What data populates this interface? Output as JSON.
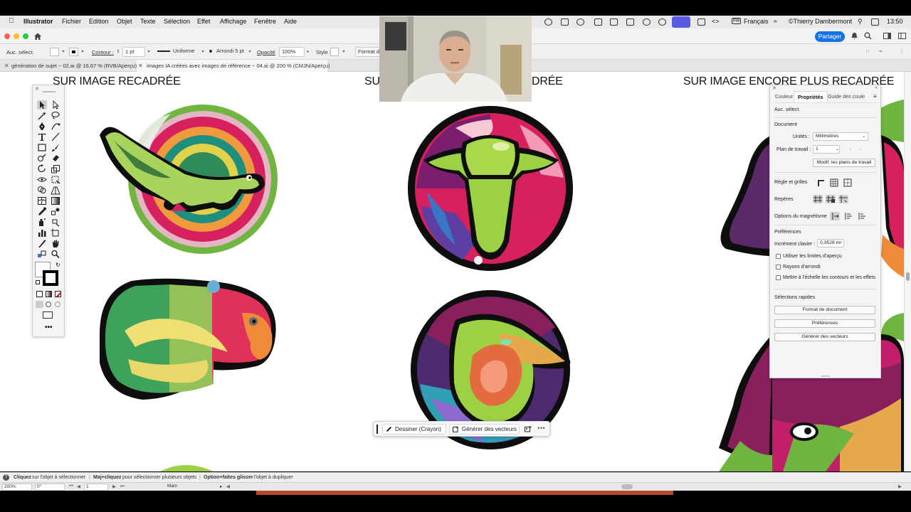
{
  "menubar": {
    "app_name": "Illustrator",
    "items": [
      "Fichier",
      "Edition",
      "Objet",
      "Texte",
      "Sélection",
      "Effet",
      "Affichage",
      "Fenêtre",
      "Aide"
    ],
    "input_code": "FR",
    "input_lang": "Français",
    "user": "©Thierry Dambermont",
    "clock": "13:50"
  },
  "approw": {
    "share_label": "Partager"
  },
  "controlbar": {
    "selection": "Auc. sélect.",
    "stroke_label": "Contour :",
    "stroke_weight": "1 pt",
    "stroke_profile": "Uniforme",
    "brush": "Arrondi 5 pt",
    "opacity_label": "Opacité",
    "opacity_value": "100%",
    "style_label": "Style :",
    "doc_format": "Format de"
  },
  "tabs": [
    {
      "label": "génération de sujet ~ 02.ai @ 16,67 % (RVB/Aperçu)",
      "active": false
    },
    {
      "label": "images IA créées avec images de référence ~ 04.ai @ 200 % (CMJN/Aperçu)",
      "active": true
    }
  ],
  "canvas": {
    "caption_left": "SUR IMAGE RECADRÉE",
    "caption_mid_left": "SU",
    "caption_mid_right": "DRÉE",
    "caption_right": "SUR IMAGE ENCORE PLUS RECADRÉE"
  },
  "properties": {
    "tabs": [
      "Couleur",
      "Propriétés",
      "Guide des coule"
    ],
    "selection": "Auc. sélect.",
    "document_title": "Document",
    "units_label": "Unités :",
    "units_value": "Millimètres",
    "artboard_label": "Plan de travail :",
    "artboard_value": "1",
    "edit_artboards": "Modif. les plans de travail",
    "rulers_label": "Règle et grilles",
    "guides_label": "Repères",
    "snap_label": "Options du magnétisme",
    "prefs_title": "Préférences",
    "keyboard_label": "Incrément clavier :",
    "keyboard_value": "0,3528 mr",
    "checkboxes": [
      "Utiliser les limites d'aperçu",
      "Rayons d'arrondi",
      "Mettre à l'échelle les contours et les effets"
    ],
    "quick_title": "Sélections rapides",
    "quick_buttons": [
      "Format de document",
      "Préférences",
      "Générer des vecteurs"
    ]
  },
  "taskbar": {
    "draw_label": "Dessiner (Crayon)",
    "vector_label": "Générer des vecteurs"
  },
  "hint": {
    "h1_bold": "Cliquez",
    "h1_rest": "sur l'objet à sélectionner",
    "h2_bold": "Maj+cliquez",
    "h2_rest": "pour sélectionner plusieurs objets",
    "h3_bold": "Option+faites glisser",
    "h3_rest": "l'objet à dupliquer"
  },
  "bottombar": {
    "zoom": "200%",
    "rotation": "0°",
    "artboard": "1",
    "layer": "Main"
  }
}
